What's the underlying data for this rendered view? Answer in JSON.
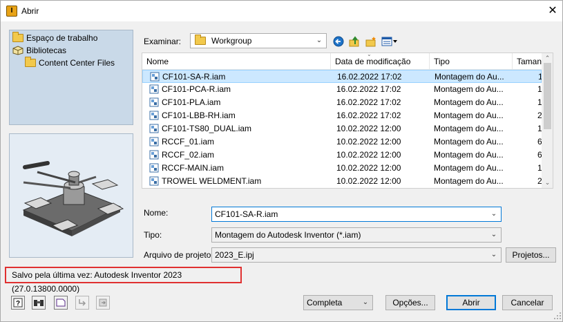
{
  "window": {
    "title": "Abrir",
    "close_glyph": "✕",
    "app_icon_glyph": "I"
  },
  "places": [
    {
      "label": "Espaço de trabalho",
      "icon": "folder-icon"
    },
    {
      "label": "Bibliotecas",
      "icon": "library-icon"
    },
    {
      "label": "Content Center Files",
      "icon": "folder-icon"
    }
  ],
  "examinar": {
    "label": "Examinar:",
    "value": "Workgroup"
  },
  "toolbar": {
    "icons": [
      "back-icon",
      "up-folder-icon",
      "new-folder-icon",
      "view-menu-icon"
    ]
  },
  "filelist": {
    "columns": [
      "Nome",
      "Data de modificação",
      "Tipo",
      "Taman"
    ],
    "rows": [
      {
        "name": "CF101-SA-R.iam",
        "date": "16.02.2022 17:02",
        "type": "Montagem do Au...",
        "size": "1",
        "selected": true
      },
      {
        "name": "CF101-PCA-R.iam",
        "date": "16.02.2022 17:02",
        "type": "Montagem do Au...",
        "size": "1"
      },
      {
        "name": "CF101-PLA.iam",
        "date": "16.02.2022 17:02",
        "type": "Montagem do Au...",
        "size": "1"
      },
      {
        "name": "CF101-LBB-RH.iam",
        "date": "16.02.2022 17:02",
        "type": "Montagem do Au...",
        "size": "2"
      },
      {
        "name": "CF101-TS80_DUAL.iam",
        "date": "10.02.2022 12:00",
        "type": "Montagem do Au...",
        "size": "1"
      },
      {
        "name": "RCCF_01.iam",
        "date": "10.02.2022 12:00",
        "type": "Montagem do Au...",
        "size": "6"
      },
      {
        "name": "RCCF_02.iam",
        "date": "10.02.2022 12:00",
        "type": "Montagem do Au...",
        "size": "6"
      },
      {
        "name": "RCCF-MAIN.iam",
        "date": "10.02.2022 12:00",
        "type": "Montagem do Au...",
        "size": "1"
      },
      {
        "name": "TROWEL WELDMENT.iam",
        "date": "10.02.2022 12:00",
        "type": "Montagem do Au...",
        "size": "2"
      }
    ]
  },
  "form": {
    "nome_label": "Nome:",
    "nome_value": "CF101-SA-R.iam",
    "tipo_label": "Tipo:",
    "tipo_value": "Montagem do Autodesk Inventor (*.iam)",
    "projeto_label": "Arquivo de projeto:",
    "projeto_value": "2023_E.ipj",
    "projetos_button": "Projetos..."
  },
  "status": {
    "text": "Salvo pela última vez: Autodesk Inventor 2023 (27.0.13800.0000)"
  },
  "footer": {
    "icons": [
      "help-icon",
      "find-icon",
      "preview-icon",
      "redirect-icon",
      "options-icon"
    ],
    "mode_value": "Completa",
    "opcoes_button": "Opções...",
    "abrir_button": "Abrir",
    "cancelar_button": "Cancelar"
  },
  "colors": {
    "accent": "#0078d7",
    "selection": "#cce8ff",
    "status_border": "#e03030",
    "places_bg": "#c9d9e8"
  }
}
